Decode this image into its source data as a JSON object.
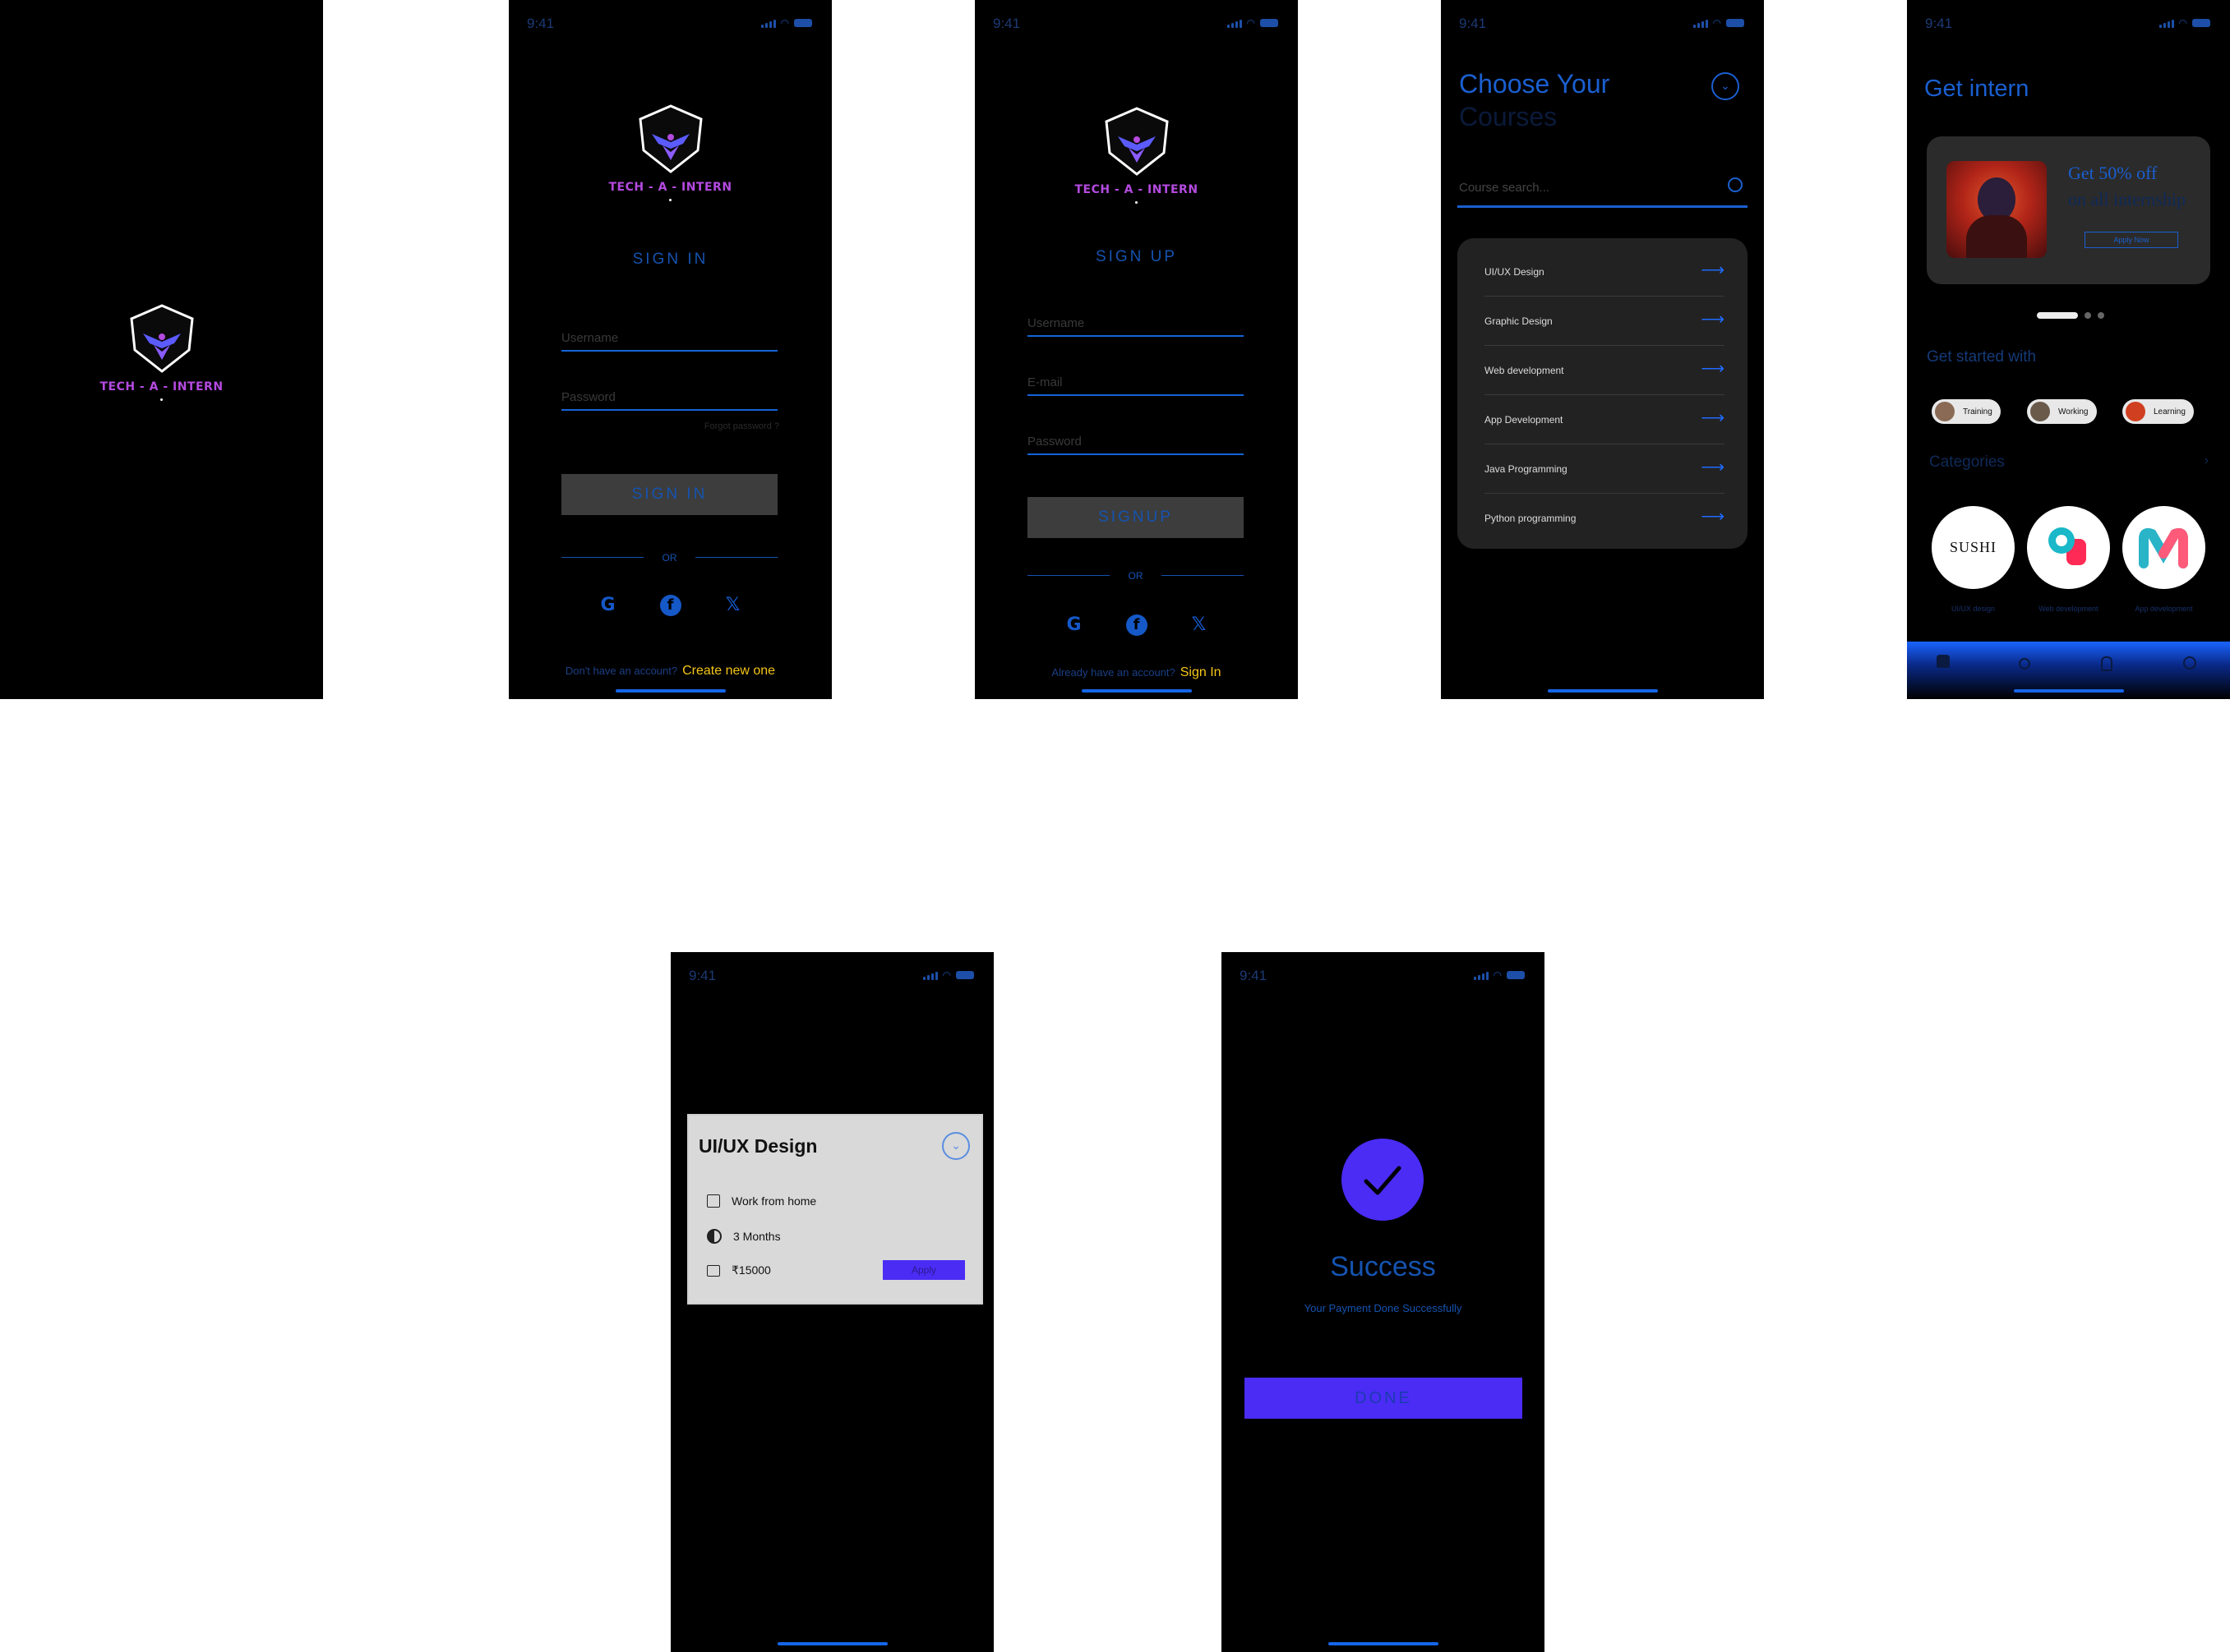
{
  "status": {
    "time": "9:41"
  },
  "brand": {
    "name": "TECH - A - INTERN"
  },
  "signin": {
    "title": "SIGN IN",
    "username_placeholder": "Username",
    "password_placeholder": "Password",
    "forgot": "Forgot password ?",
    "button": "SIGN IN",
    "or": "OR",
    "prompt": "Don't have an account?",
    "link": "Create new one"
  },
  "signup": {
    "title": "SIGN UP",
    "username_placeholder": "Username",
    "email_placeholder": "E-mail",
    "password_placeholder": "Password",
    "button": "SIGNUP",
    "or": "OR",
    "prompt": "Already have an account?",
    "link": "Sign In"
  },
  "courses": {
    "title_line1": "Choose Your",
    "title_line2": "Courses",
    "search_placeholder": "Course search...",
    "items": [
      {
        "label": "UI/UX Design"
      },
      {
        "label": "Graphic Design"
      },
      {
        "label": "Web  development"
      },
      {
        "label": "App Development"
      },
      {
        "label": "Java Programming"
      },
      {
        "label": "Python programming"
      }
    ]
  },
  "home": {
    "title": "Get intern",
    "promo_line1": "Get 50% off",
    "promo_line2": "on all internship",
    "promo_button": "Apply Now",
    "section1": "Get started with",
    "chips": [
      {
        "label": "Training"
      },
      {
        "label": "Working"
      },
      {
        "label": "Learning"
      }
    ],
    "section2": "Categories",
    "categories": [
      {
        "label": "UI/UX design"
      },
      {
        "label": "Web development"
      },
      {
        "label": "App development"
      }
    ],
    "sushi_text": "SUSHI"
  },
  "detail": {
    "title": "UI/UX Design",
    "mode": "Work from home",
    "duration": "3 Months",
    "price": "₹15000",
    "apply": "Apply"
  },
  "success": {
    "title": "Success",
    "message": "Your Payment  Done Successfully",
    "button": "DONE"
  },
  "colors": {
    "accent_blue": "#1553b0",
    "purple": "#4a2cf5",
    "yellow": "#f5c518",
    "brand_purple": "#b44ae0"
  }
}
